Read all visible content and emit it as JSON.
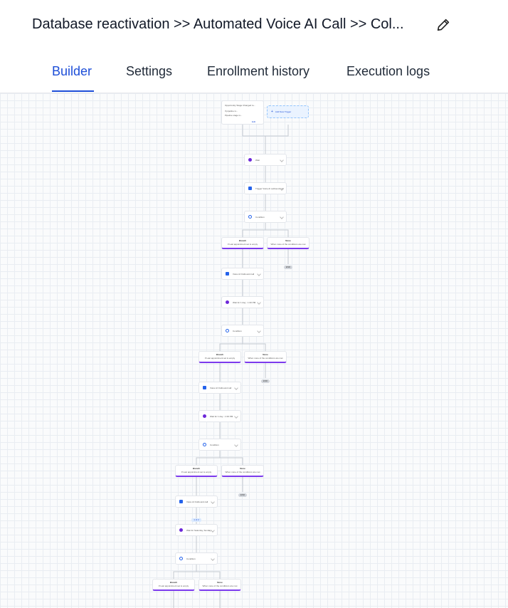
{
  "header": {
    "title": "Database reactivation >> Automated Voice AI Call >> Col..."
  },
  "tabs": [
    {
      "label": "Builder",
      "active": true
    },
    {
      "label": "Settings",
      "active": false
    },
    {
      "label": "Enrollment history",
      "active": false
    },
    {
      "label": "Execution logs",
      "active": false
    }
  ],
  "colors": {
    "accent": "#1d4ed8",
    "branch_border": "#7c3aed"
  },
  "workflow": {
    "trigger": {
      "lines": [
        "Opportunity Stage Changed to...",
        "If pipeline is...",
        "Pipeline stage is..."
      ],
      "edit_label": "Edit",
      "add_trigger_label": "Add New Trigger"
    },
    "nodes": [
      {
        "type": "wait",
        "label": "Wait"
      },
      {
        "type": "call",
        "label": "Trigger Voice AI outbound call"
      },
      {
        "type": "cond",
        "label": "Condition"
      },
      {
        "type": "call",
        "label": "Voice AI Outbound call"
      },
      {
        "type": "wait",
        "label": "Wait for 1 day - 1:00 PM"
      },
      {
        "type": "cond",
        "label": "Condition"
      },
      {
        "type": "call",
        "label": "Voice AI Outbound call"
      },
      {
        "type": "wait",
        "label": "Wait for 1 day - 1:00 PM"
      },
      {
        "type": "cond",
        "label": "Condition"
      },
      {
        "type": "call",
        "label": "Voice AI Outbound call"
      },
      {
        "type": "wait",
        "label": "Wait for Saturday, Sunday"
      },
      {
        "type": "cond",
        "label": "Condition"
      }
    ],
    "branch_left": {
      "title": "Branch",
      "desc": "If Last appointment set is empty"
    },
    "branch_right": {
      "title": "None",
      "desc": "When none of the conditions are met"
    },
    "end_label": "END",
    "chip_label": "1 of 2"
  }
}
